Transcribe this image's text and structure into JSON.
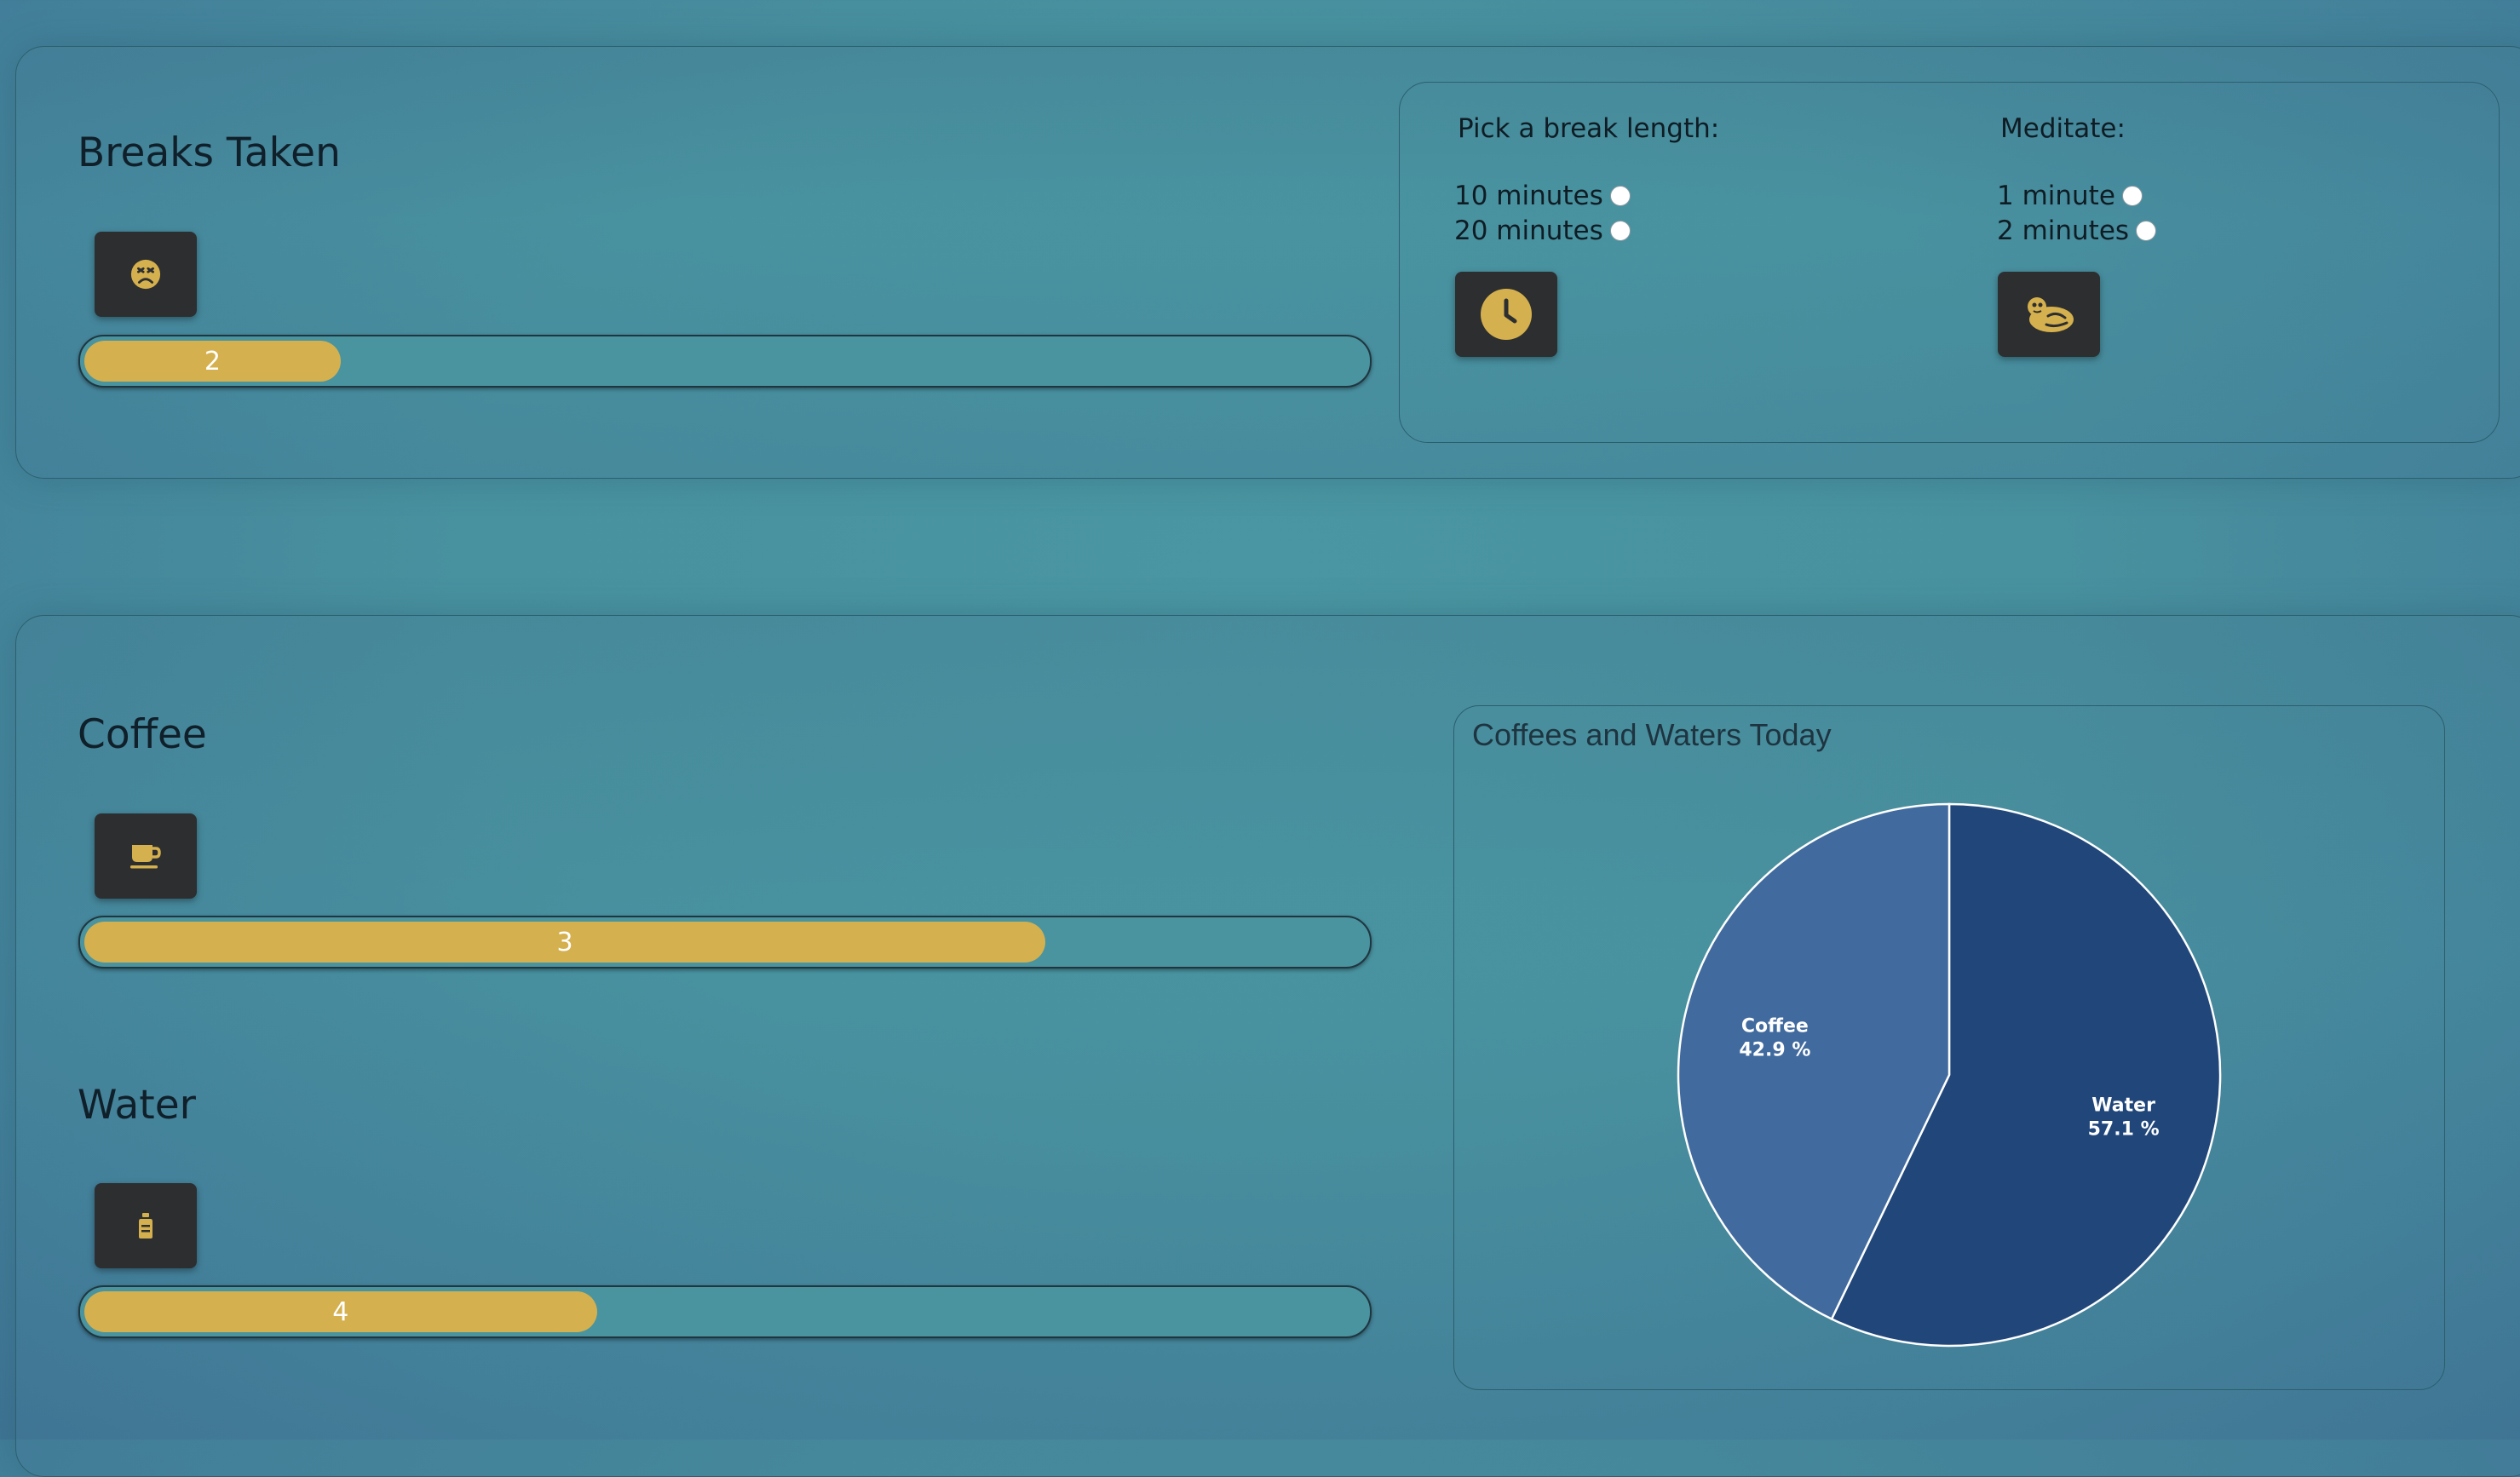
{
  "breaks": {
    "title": "Breaks Taken",
    "icon": "sad-face-icon",
    "count": "2",
    "progress_fraction": 0.2
  },
  "break_options": {
    "length_heading": "Pick a break length:",
    "length_options": [
      "10 minutes",
      "20 minutes"
    ],
    "clock_icon": "clock-icon",
    "meditate_heading": "Meditate:",
    "meditate_options": [
      "1 minute",
      "2 minutes"
    ],
    "meditate_icon": "meditation-icon"
  },
  "coffee": {
    "title": "Coffee",
    "icon": "coffee-cup-icon",
    "count": "3",
    "progress_fraction": 0.75
  },
  "water": {
    "title": "Water",
    "icon": "water-bottle-icon",
    "count": "4",
    "progress_fraction": 0.4
  },
  "colors": {
    "accent": "#d4b04e",
    "button_bg": "#2d2e30",
    "water_slice": "#20467a",
    "coffee_slice": "#416a9e"
  },
  "chart_data": {
    "type": "pie",
    "title": "Coffees and Waters Today",
    "categories": [
      "Water",
      "Coffee"
    ],
    "values": [
      4,
      3
    ],
    "percent_labels": [
      "57.1 %",
      "42.9 %"
    ]
  }
}
